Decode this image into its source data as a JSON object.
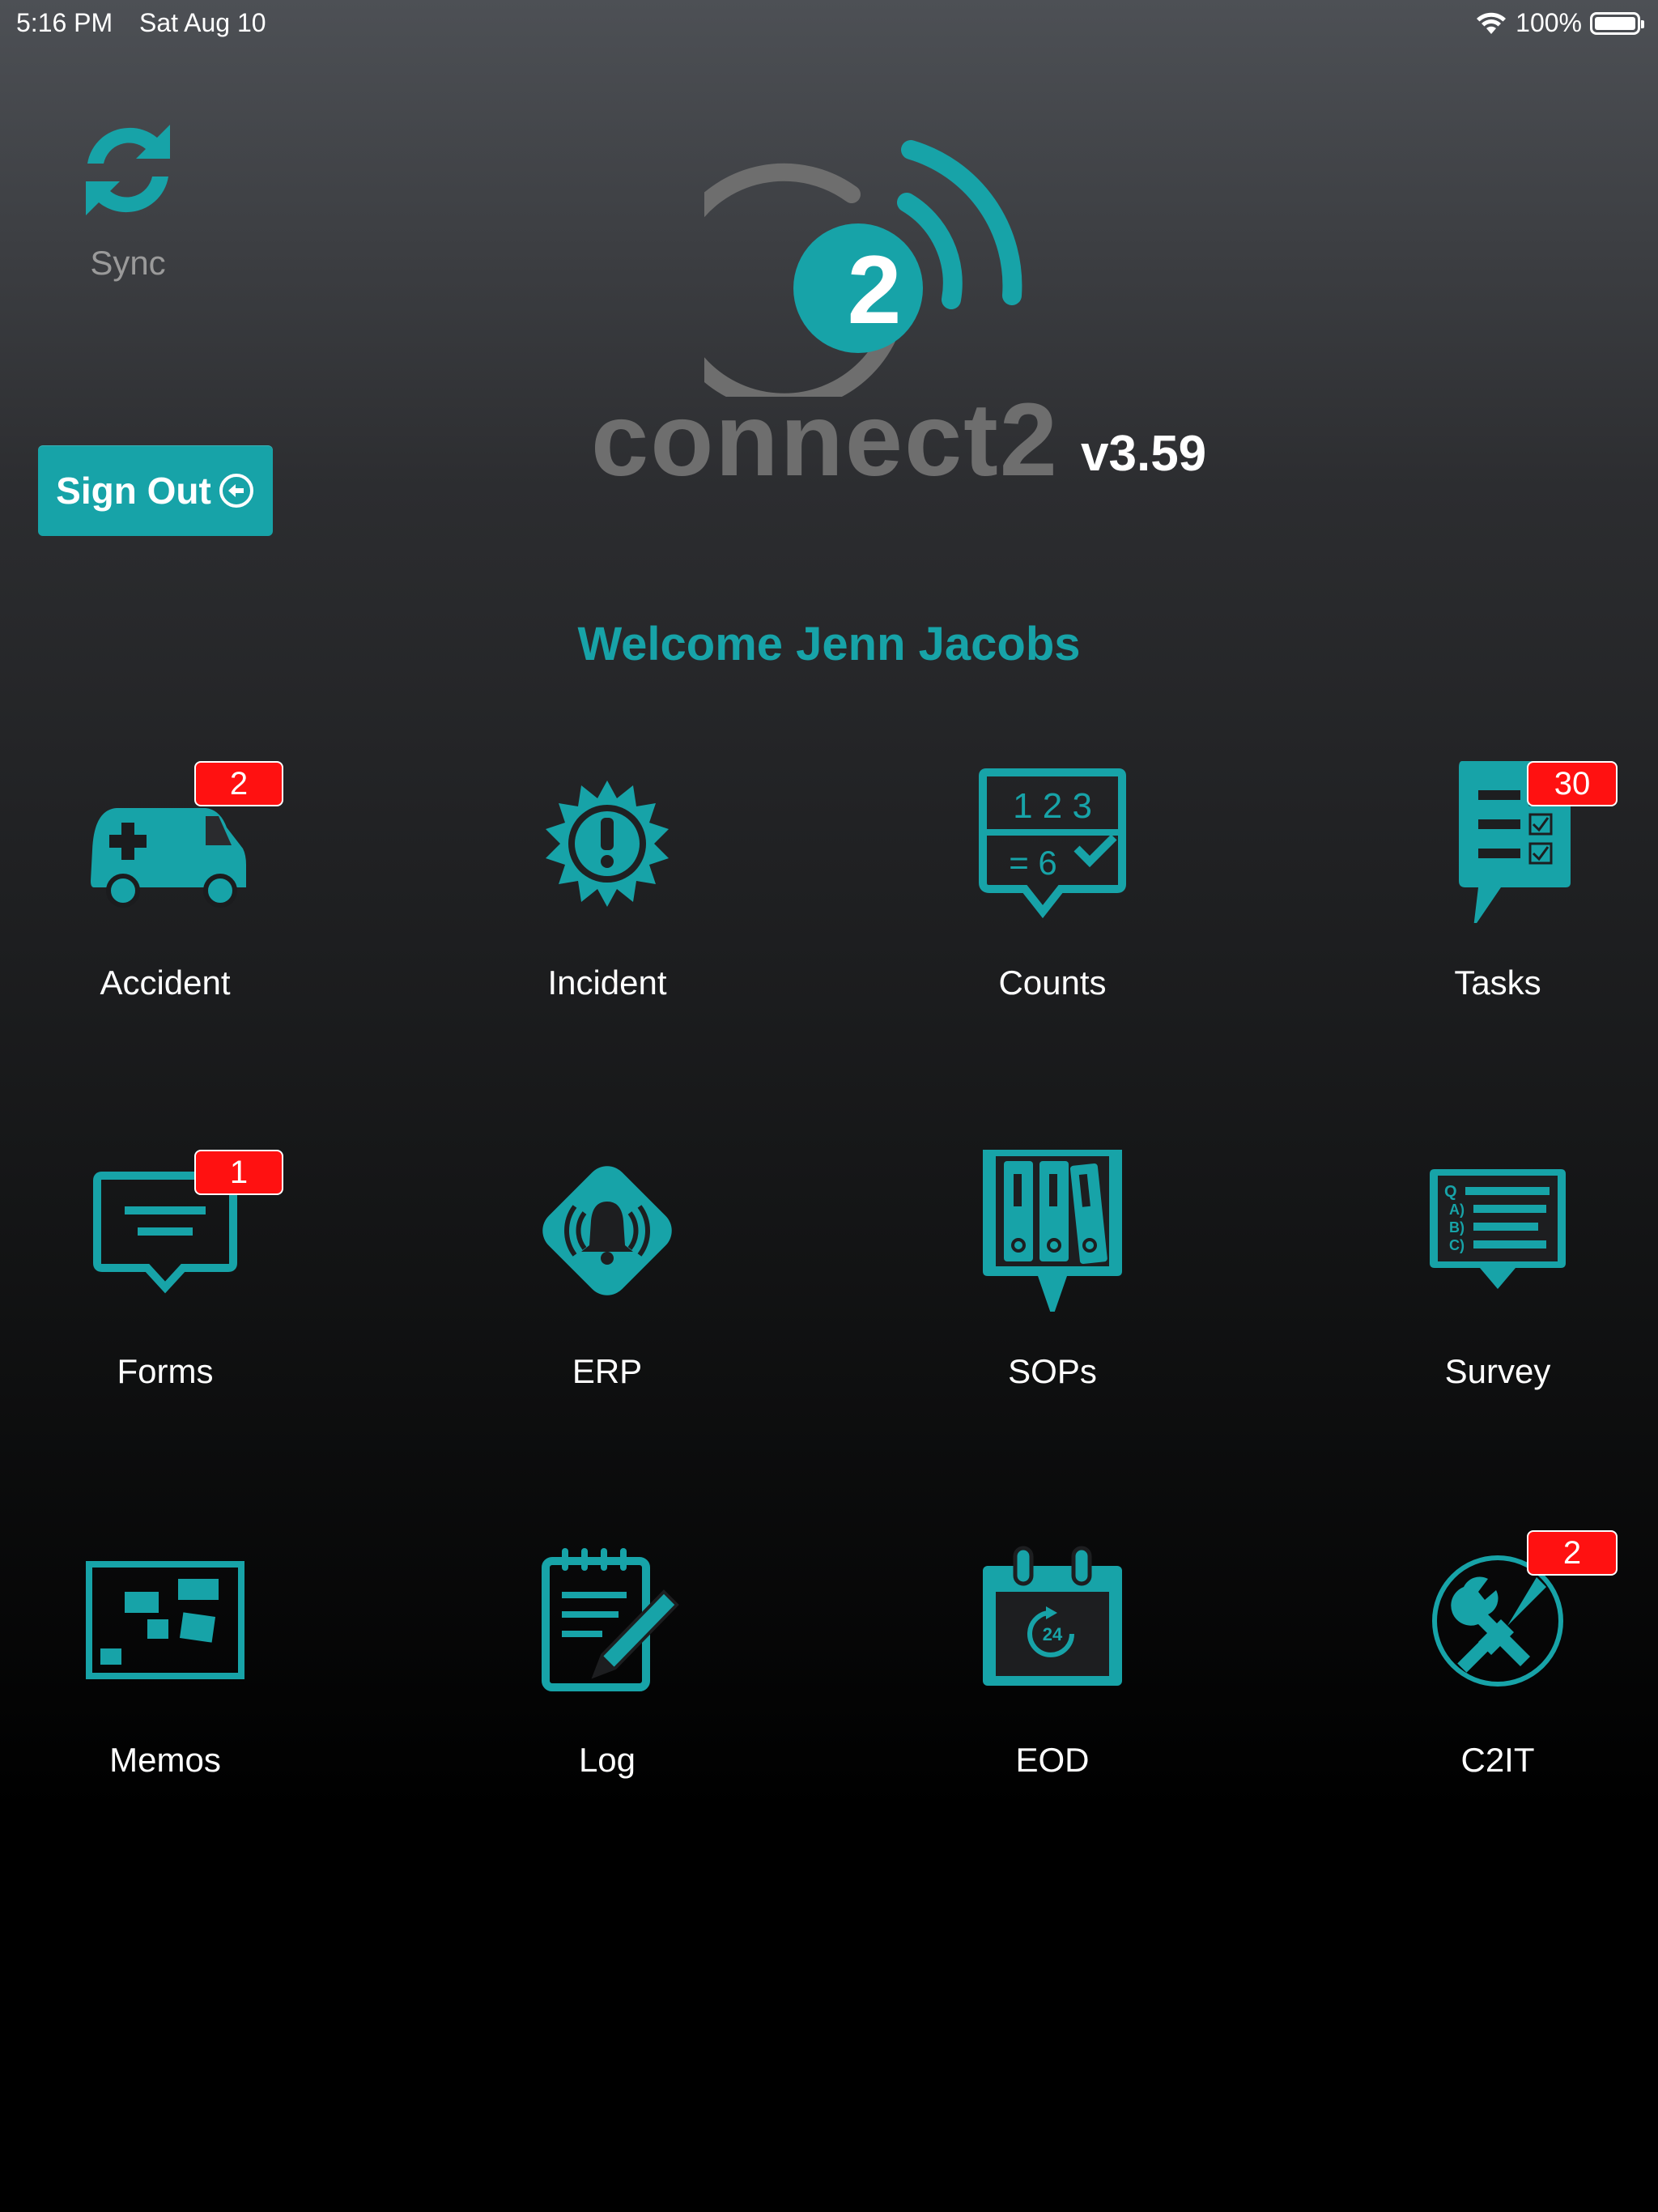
{
  "status_bar": {
    "time": "5:16 PM",
    "date": "Sat Aug 10",
    "battery": "100%",
    "icons": [
      "wifi-icon",
      "battery-icon"
    ]
  },
  "sync": {
    "label": "Sync",
    "icon": "sync-icon"
  },
  "sign_out": {
    "label": "Sign Out",
    "icon": "sign-out-arrow-icon"
  },
  "logo": {
    "wordmark": "connect2",
    "badge_digit": "2",
    "version": "v3.59"
  },
  "welcome": "Welcome Jenn Jacobs",
  "colors": {
    "accent": "#17a3a8",
    "badge": "#ff1111",
    "muted": "#6e6e6e"
  },
  "tiles": [
    {
      "label": "Accident",
      "icon": "ambulance-icon",
      "badge": "2"
    },
    {
      "label": "Incident",
      "icon": "alert-burst-icon",
      "badge": ""
    },
    {
      "label": "Counts",
      "icon": "counts-bubble-icon",
      "badge": "",
      "icon_text": [
        "1 2 3",
        "= 6"
      ]
    },
    {
      "label": "Tasks",
      "icon": "checklist-icon",
      "badge": "30"
    },
    {
      "label": "Forms",
      "icon": "message-bubble-icon",
      "badge": "1"
    },
    {
      "label": "ERP",
      "icon": "alarm-bell-icon",
      "badge": ""
    },
    {
      "label": "SOPs",
      "icon": "binders-icon",
      "badge": ""
    },
    {
      "label": "Survey",
      "icon": "survey-icon",
      "badge": "",
      "icon_text": [
        "Q",
        "A)",
        "B)",
        "C)"
      ]
    },
    {
      "label": "Memos",
      "icon": "memo-board-icon",
      "badge": ""
    },
    {
      "label": "Log",
      "icon": "notepad-pencil-icon",
      "badge": ""
    },
    {
      "label": "EOD",
      "icon": "calendar-24-icon",
      "badge": "",
      "icon_text": [
        "24"
      ]
    },
    {
      "label": "C2IT",
      "icon": "tools-icon",
      "badge": "2"
    }
  ]
}
